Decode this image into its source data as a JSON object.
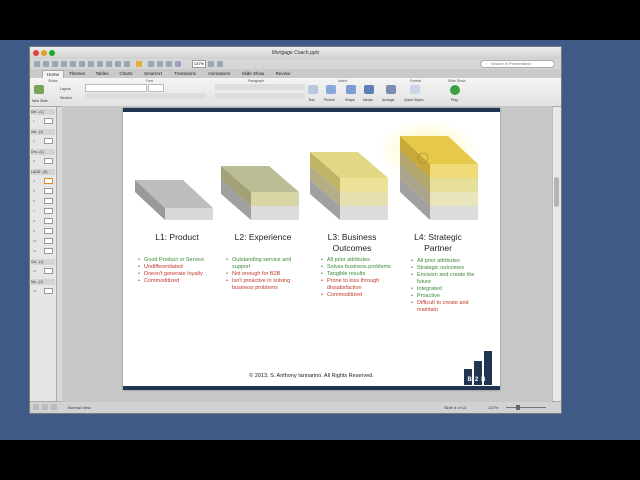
{
  "window": {
    "title": "Mortgage Coach.pptx",
    "search_placeholder": "Search in Presentation",
    "zoom": "137%"
  },
  "ribbon_tabs": [
    "Home",
    "Themes",
    "Tables",
    "Charts",
    "SmartArt",
    "Transitions",
    "Animations",
    "Slide Show",
    "Review"
  ],
  "ribbon": {
    "groups": [
      "Slides",
      "Font",
      "Paragraph",
      "Insert",
      "Format",
      "Slide Show"
    ],
    "new_slide": "New Slide",
    "layout": "Layout",
    "section": "Section",
    "buttons": [
      "Text",
      "Picture",
      "Shape",
      "Media",
      "Arrange",
      "Quick Styles",
      "Play"
    ]
  },
  "sidebar": {
    "sections": [
      "Def...(1)",
      "Intr...(1)",
      "Dra...(1)",
      "LADD...(8)",
      "Clo...(1)",
      "Mo...(1)"
    ],
    "slide_numbers": [
      "1",
      "2",
      "3",
      "4",
      "5",
      "6",
      "7",
      "8",
      "9",
      "10",
      "11",
      "12",
      "13"
    ]
  },
  "slide": {
    "levels": [
      {
        "title": "L1: Product",
        "items": [
          {
            "text": "Good Product or Service",
            "color": "green"
          },
          {
            "text": "Undifferentiated",
            "color": "red"
          },
          {
            "text": "Doesn't generate loyalty",
            "color": "red"
          },
          {
            "text": "Commoditized",
            "color": "red"
          }
        ]
      },
      {
        "title": "L2: Experience",
        "items": [
          {
            "text": "Outstanding service and support",
            "color": "green"
          },
          {
            "text": "Not enough for B2B",
            "color": "red"
          },
          {
            "text": "Isn't proactive in solving business problems",
            "color": "red"
          }
        ]
      },
      {
        "title": "L3: Business Outcomes",
        "items": [
          {
            "text": "All prior attributes",
            "color": "green"
          },
          {
            "text": "Solves business problems",
            "color": "green"
          },
          {
            "text": "Tangible results",
            "color": "green"
          },
          {
            "text": "Prone to loss through dissatisfaction",
            "color": "red"
          },
          {
            "text": "Commoditized",
            "color": "red"
          }
        ]
      },
      {
        "title": "L4: Strategic Partner",
        "items": [
          {
            "text": "All prior attributes",
            "color": "green"
          },
          {
            "text": "Strategic outcomes",
            "color": "green"
          },
          {
            "text": "Envision and create the future",
            "color": "green"
          },
          {
            "text": "Integrated",
            "color": "green"
          },
          {
            "text": "Proactive",
            "color": "green"
          },
          {
            "text": "Difficult to create and maintain",
            "color": "red"
          }
        ]
      }
    ],
    "copyright": "© 2013, S. Anthony Iannarino. All Rights Reserved.",
    "logo_text": "B2B"
  },
  "status": {
    "view": "Normal View",
    "slide_of": "Slide 4 of 13",
    "zoom": "137%"
  },
  "colors": {
    "desktop": "#3f5a86",
    "slide_bar": "#1f3551",
    "green_text": "#3b8a35",
    "red_text": "#c0392b",
    "gold_block": "#e6c94a"
  }
}
